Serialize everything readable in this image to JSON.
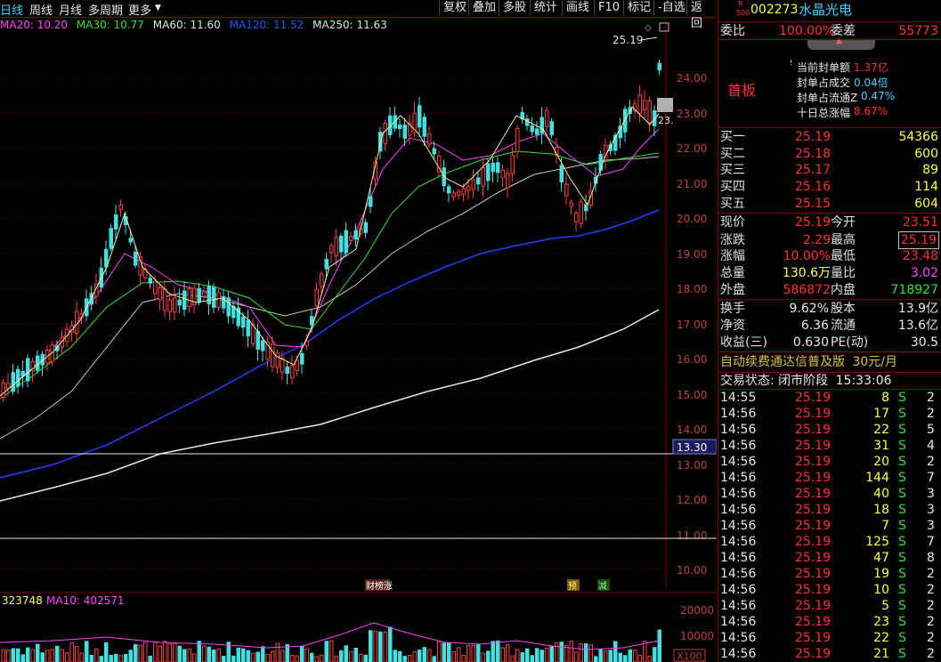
{
  "toolbar": {
    "left": [
      "日线",
      "周线",
      "月线",
      "多周期",
      "更多"
    ],
    "right": [
      "复权",
      "叠加",
      "多股",
      "统计",
      "画线",
      "F10",
      "标记",
      "-自选",
      "返回"
    ]
  },
  "ma_legend": [
    {
      "label": "MA20: 10.20",
      "color": "#ff40ff"
    },
    {
      "label": "MA30: 10.77",
      "color": "#30e030"
    },
    {
      "label": "MA60: 11.60",
      "color": "#e0e0e0"
    },
    {
      "label": "MA120: 11.52",
      "color": "#3050ff"
    },
    {
      "label": "MA250: 11.63",
      "color": "#e0e0e0"
    }
  ],
  "chart": {
    "price_ticks": [
      "24.00",
      "23.00",
      "22.00",
      "21.00",
      "20.00",
      "19.00",
      "18.00",
      "17.00",
      "16.00",
      "15.00",
      "14.00",
      "13.00",
      "12.00",
      "11.00",
      "10.00"
    ],
    "high_label": "25.19",
    "last_label": "23.",
    "cursor_price": "13.30",
    "events": [
      "财榜涨",
      "预",
      "减"
    ],
    "vol_legend": [
      {
        "label": "323748",
        "color": "#ffff40"
      },
      {
        "label": "MA10: 402571",
        "color": "#ff40ff"
      }
    ],
    "vol_ticks": [
      "20000",
      "10000"
    ],
    "vol_unit": "X100"
  },
  "stock": {
    "code": "002273",
    "name": "水晶光电",
    "badge_top": "R",
    "badge_bottom": "500"
  },
  "ratio": {
    "label1": "委比",
    "value1": "100.00%",
    "label2": "委差",
    "value2": "55773"
  },
  "board": {
    "title": "首板",
    "items": [
      {
        "label": "当前封单额",
        "value": "1.37亿"
      },
      {
        "label": "封单占成交",
        "value": "0.04倍"
      },
      {
        "label": "封单占流通Z",
        "value": "0.47%"
      },
      {
        "label": "十日总涨幅",
        "value": "8.67%"
      }
    ]
  },
  "bids": [
    {
      "label": "买一",
      "price": "25.19",
      "vol": "54366"
    },
    {
      "label": "买二",
      "price": "25.18",
      "vol": "600"
    },
    {
      "label": "买三",
      "price": "25.17",
      "vol": "89"
    },
    {
      "label": "买四",
      "price": "25.16",
      "vol": "114"
    },
    {
      "label": "买五",
      "price": "25.15",
      "vol": "604"
    }
  ],
  "quote": [
    {
      "l1": "现价",
      "v1": "25.19",
      "l2": "今开",
      "v2": "23.51"
    },
    {
      "l1": "涨跌",
      "v1": "2.29",
      "l2": "最高",
      "v2": "25.19"
    },
    {
      "l1": "涨幅",
      "v1": "10.00%",
      "l2": "最低",
      "v2": "23.48"
    },
    {
      "l1": "总量",
      "v1": "130.6万",
      "l2": "量比",
      "v2": "3.02"
    },
    {
      "l1": "外盘",
      "v1": "586872",
      "l2": "内盘",
      "v2": "718927"
    }
  ],
  "fund": [
    {
      "l1": "换手",
      "v1": "9.62%",
      "l2": "股本",
      "v2": "13.9亿"
    },
    {
      "l1": "净资",
      "v1": "6.36",
      "l2": "流通",
      "v2": "13.6亿"
    },
    {
      "l1": "收益(三)",
      "v1": "0.630",
      "l2": "PE(动)",
      "v2": "30.5"
    }
  ],
  "promo": {
    "text": "自动续费通达信普及版",
    "price": "30元/月"
  },
  "status": {
    "label": "交易状态:",
    "phase": "闭市阶段",
    "time": "15:33:06"
  },
  "ticks": [
    {
      "t": "14:55",
      "p": "25.19",
      "v": "8",
      "s": "S",
      "n": "2"
    },
    {
      "t": "14:56",
      "p": "25.19",
      "v": "17",
      "s": "S",
      "n": "2"
    },
    {
      "t": "14:56",
      "p": "25.19",
      "v": "22",
      "s": "S",
      "n": "5"
    },
    {
      "t": "14:56",
      "p": "25.19",
      "v": "31",
      "s": "S",
      "n": "4"
    },
    {
      "t": "14:56",
      "p": "25.19",
      "v": "20",
      "s": "S",
      "n": "2"
    },
    {
      "t": "14:56",
      "p": "25.19",
      "v": "144",
      "s": "S",
      "n": "7"
    },
    {
      "t": "14:56",
      "p": "25.19",
      "v": "40",
      "s": "S",
      "n": "3"
    },
    {
      "t": "14:56",
      "p": "25.19",
      "v": "18",
      "s": "S",
      "n": "3"
    },
    {
      "t": "14:56",
      "p": "25.19",
      "v": "7",
      "s": "S",
      "n": "3"
    },
    {
      "t": "14:56",
      "p": "25.19",
      "v": "125",
      "s": "S",
      "n": "7"
    },
    {
      "t": "14:56",
      "p": "25.19",
      "v": "47",
      "s": "S",
      "n": "8"
    },
    {
      "t": "14:56",
      "p": "25.19",
      "v": "19",
      "s": "S",
      "n": "2"
    },
    {
      "t": "14:56",
      "p": "25.19",
      "v": "10",
      "s": "S",
      "n": "2"
    },
    {
      "t": "14:56",
      "p": "25.19",
      "v": "5",
      "s": "S",
      "n": "2"
    },
    {
      "t": "14:56",
      "p": "25.19",
      "v": "23",
      "s": "S",
      "n": "2"
    },
    {
      "t": "14:56",
      "p": "25.19",
      "v": "22",
      "s": "S",
      "n": "2"
    },
    {
      "t": "14:56",
      "p": "25.19",
      "v": "21",
      "s": "S",
      "n": "2"
    }
  ]
}
